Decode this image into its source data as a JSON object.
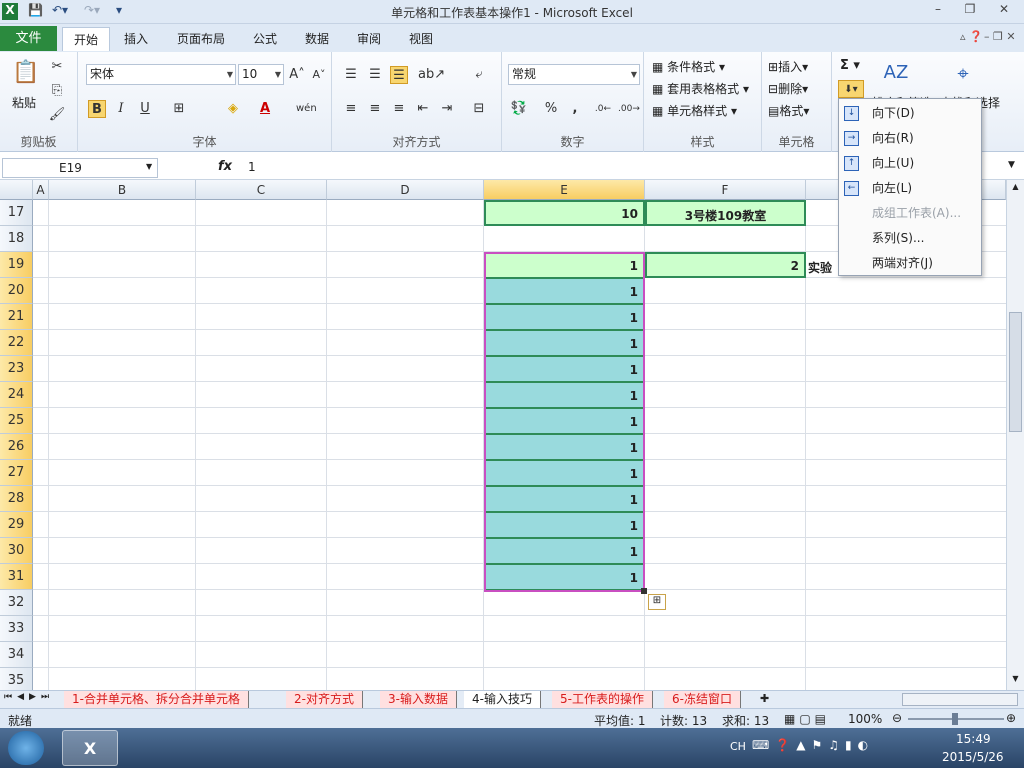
{
  "window": {
    "title": "单元格和工作表基本操作1 - Microsoft Excel"
  },
  "ribbon_tabs": [
    "文件",
    "开始",
    "插入",
    "页面布局",
    "公式",
    "数据",
    "审阅",
    "视图"
  ],
  "clipboard": {
    "paste": "粘贴",
    "group": "剪贴板"
  },
  "font": {
    "name": "宋体",
    "size": "10",
    "bold": "B",
    "italic": "I",
    "underline": "U",
    "group": "字体"
  },
  "alignment": {
    "group": "对齐方式"
  },
  "number": {
    "format": "常规",
    "percent": "%",
    "comma": ",",
    "group": "数字"
  },
  "styles": {
    "conditional": "条件格式",
    "table": "套用表格格式",
    "cell": "单元格样式",
    "group": "样式"
  },
  "cells": {
    "insert": "插入",
    "delete": "删除",
    "format": "格式",
    "group": "单元格"
  },
  "editing": {
    "sigma": "Σ",
    "sort": "排序和筛选",
    "find": "查找和选择"
  },
  "formula_bar": {
    "name_box": "E19",
    "fx": "fx",
    "value": "1"
  },
  "columns": [
    "A",
    "B",
    "C",
    "D",
    "E",
    "F"
  ],
  "rows": [
    "17",
    "18",
    "19",
    "20",
    "21",
    "22",
    "23",
    "24",
    "25",
    "26",
    "27",
    "28",
    "29",
    "30",
    "31",
    "32",
    "33",
    "34",
    "35"
  ],
  "cellvals": {
    "e17": "10",
    "f17": "3号楼109教室",
    "f19": "2",
    "g19": "实验",
    "e_fill": [
      "1",
      "1",
      "1",
      "1",
      "1",
      "1",
      "1",
      "1",
      "1",
      "1",
      "1",
      "1",
      "1"
    ]
  },
  "fill_menu": {
    "items": [
      "向下(D)",
      "向右(R)",
      "向上(U)",
      "向左(L)",
      "成组工作表(A)...",
      "系列(S)...",
      "两端对齐(J)"
    ]
  },
  "sheet_tabs": [
    "1-合并单元格、拆分合并单元格",
    "2-对齐方式",
    "3-输入数据",
    "4-输入技巧",
    "5-工作表的操作",
    "6-冻结窗口"
  ],
  "status": {
    "ready": "就绪",
    "average": "平均值: 1",
    "count": "计数: 13",
    "sum": "求和: 13",
    "zoom": "100%"
  },
  "taskbar": {
    "lang": "CH",
    "time": "15:49",
    "date": "2015/5/26"
  }
}
